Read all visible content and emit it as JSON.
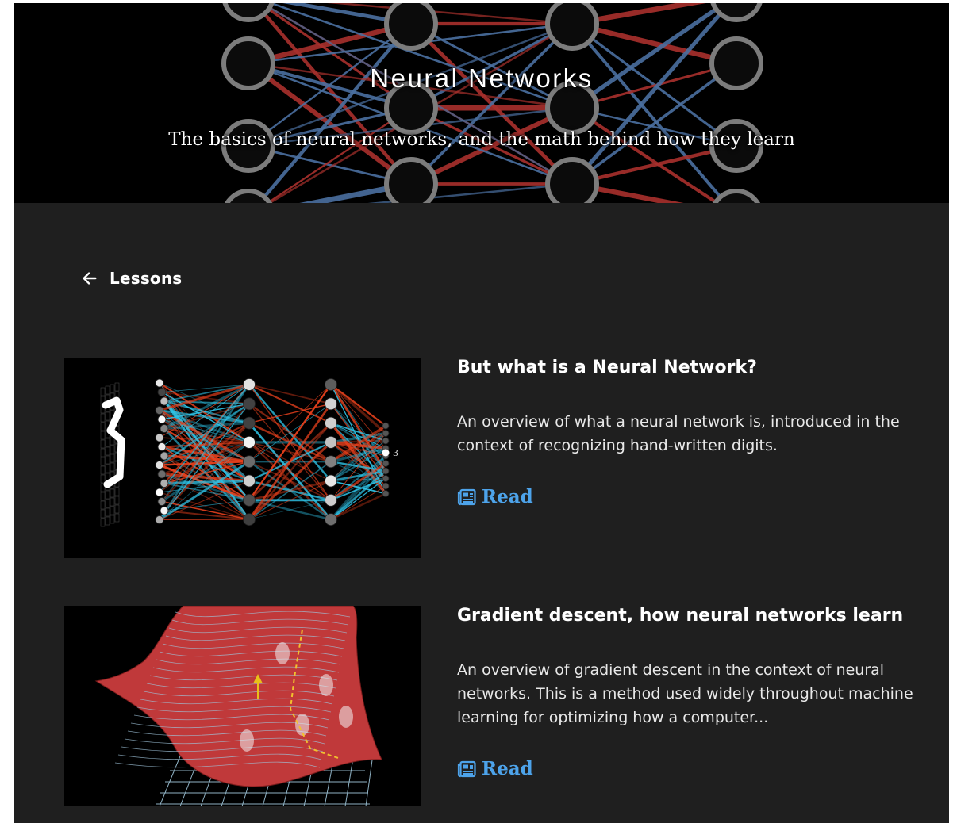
{
  "hero": {
    "title": "Neural Networks",
    "subtitle": "The basics of neural networks, and the math behind how they learn"
  },
  "nav": {
    "back_label": "Lessons",
    "back_icon": "arrow-left-icon"
  },
  "lessons": [
    {
      "title": "But what is a Neural Network?",
      "description": "An overview of what a neural network is, introduced in the context of recognizing hand-written digits.",
      "read_label": "Read",
      "read_icon": "newspaper-icon",
      "thumbnail_output_label": "3"
    },
    {
      "title": "Gradient descent, how neural networks learn",
      "description": "An overview of gradient descent in the context of neural networks. This is a method used widely throughout machine learning for optimizing how a computer...",
      "read_label": "Read",
      "read_icon": "newspaper-icon"
    }
  ],
  "colors": {
    "background": "#1f1f1f",
    "hero_background": "#000000",
    "link": "#4da3ea",
    "edge_red": "#a8302c",
    "edge_blue": "#4a6fa0",
    "surface_red": "#c0393a"
  }
}
